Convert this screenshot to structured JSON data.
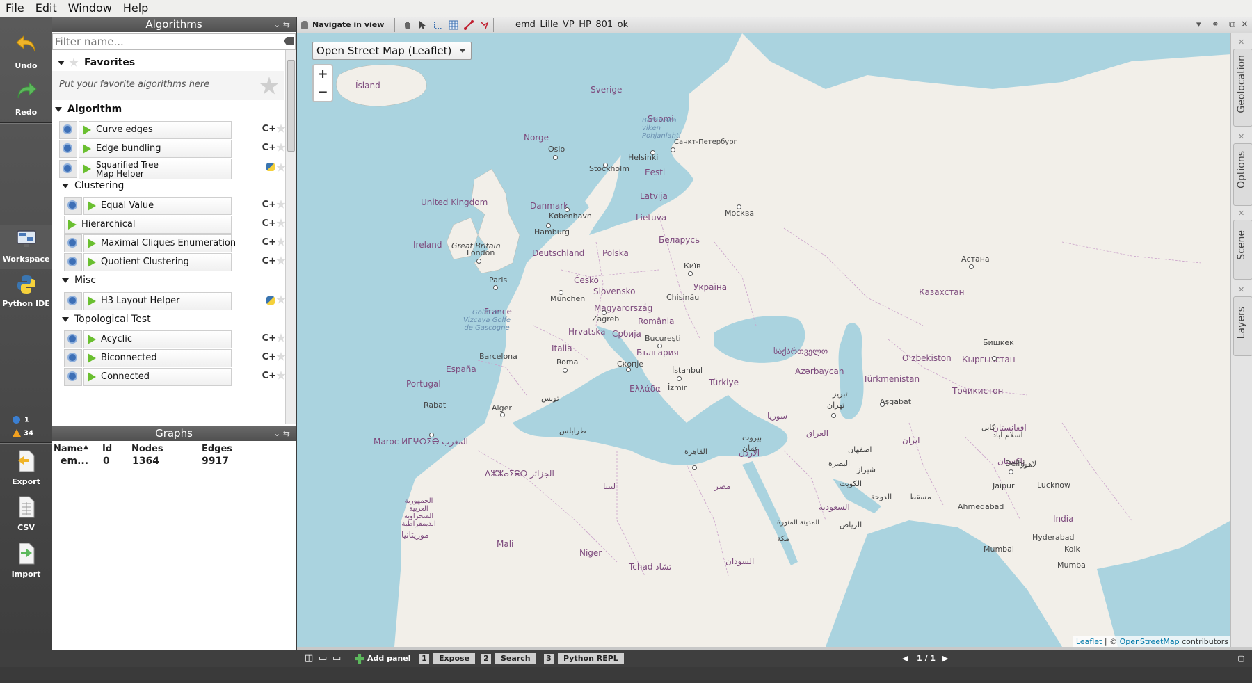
{
  "menu": [
    "File",
    "Edit",
    "Window",
    "Help"
  ],
  "left_toolbar": {
    "undo": "Undo",
    "redo": "Redo",
    "workspace": "Workspace",
    "python_ide": "Python IDE",
    "info_count": "1",
    "warning_count": "34",
    "export": "Export",
    "csv": "CSV",
    "import": "Import"
  },
  "algorithms": {
    "title": "Algorithms",
    "filter_placeholder": "Filter name...",
    "favorites": "Favorites",
    "favorites_hint": "Put your favorite algorithms here",
    "cat_algorithm": "Algorithm",
    "items_algorithm": [
      "Curve edges",
      "Edge bundling",
      "Squarified Tree",
      "Map Helper"
    ],
    "cat_clustering": "Clustering",
    "items_clustering": [
      "Equal Value",
      "Hierarchical",
      "Maximal Cliques Enumeration",
      "Quotient Clustering"
    ],
    "cat_misc": "Misc",
    "items_misc": [
      "H3 Layout Helper"
    ],
    "cat_topological": "Topological Test",
    "items_topological": [
      "Acyclic",
      "Biconnected",
      "Connected"
    ],
    "lang_cpp": "C+"
  },
  "graphs": {
    "title": "Graphs",
    "headers": [
      "Name",
      "Id",
      "Nodes",
      "Edges"
    ],
    "row": [
      "em...",
      "0",
      "1364",
      "9917"
    ]
  },
  "workspace": {
    "navigate": "Navigate in view",
    "tab_title": "emd_Lille_VP_HP_801_ok",
    "basemap": "Open Street Map (Leaflet)",
    "zoom_in": "+",
    "zoom_out": "−",
    "attribution_leaflet": "Leaflet",
    "attribution_sep": " | © ",
    "attribution_osm": "OpenStreetMap",
    "attribution_tail": " contributors",
    "side_tabs": [
      "Geolocation",
      "Options",
      "Scene",
      "Layers"
    ]
  },
  "bottom": {
    "add_panel": "Add panel",
    "expose_num": "1",
    "expose": "Expose",
    "search_num": "2",
    "search": "Search",
    "python_num": "3",
    "python": "Python REPL",
    "page": "1 / 1"
  },
  "map_labels": {
    "countries": [
      "Ísland",
      "Sverige",
      "Suomi",
      "Norge",
      "Eesti",
      "Latvija",
      "Lietuva",
      "Danmark",
      "United Kingdom",
      "Ireland",
      "Deutschland",
      "Polska",
      "Беларусь",
      "Україна",
      "France",
      "Česko",
      "Slovensko",
      "Magyarország",
      "România",
      "Hrvatska",
      "Србија",
      "България",
      "Italia",
      "España",
      "Portugal",
      "Türkiye",
      "Ελλάδα",
      "Azərbaycan",
      "Türkmenistan",
      "Oʻzbekiston",
      "Казахстан",
      "Кыргызстан",
      "Точикистон",
      "Maroc ⵍⵎⵖⵔⵉⴱ المغرب",
      "ⴷⵣⵣⴰⵢⴻⵔ الجزائر",
      "ليبيا",
      "مصر",
      "السودان",
      "Niger",
      "Mali",
      "Tchad تشاد",
      "India",
      "پاکستان",
      "افغانستان",
      "ایران",
      "العراق",
      "سوريا",
      "الأردن",
      "السعودية",
      "موريتانيا",
      "الجمهورية العربية الصحراوية الديمقراطية",
      "საქართველო",
      "Chisinău"
    ],
    "cities": [
      "Oslo",
      "Stockholm",
      "Helsinki",
      "Санкт-Петербург",
      "Москва",
      "København",
      "Hamburg",
      "London",
      "Great Britain",
      "Paris",
      "München",
      "Zagreb",
      "Київ",
      "Bucureşti",
      "Barcelona",
      "Roma",
      "Скопје",
      "İstanbul",
      "İzmir",
      "Rabat",
      "Alger",
      "تونس",
      "طرابلس",
      "القاهرة",
      "Астана",
      "Бишкек",
      "Aşgabat",
      "تهران",
      "Delhi",
      "Jaipur",
      "Lucknow",
      "Ahmedabad",
      "Mumbai",
      "Hyderabad",
      "Kolk",
      "Mumba",
      "الدوحة",
      "مسقط",
      "الرياض",
      "مكة",
      "المدينة المنورة",
      "اصفهان",
      "شيراز",
      "لاهور",
      "اسلام آباد",
      "كابل",
      "الكويت",
      "البصرة",
      "بيروت",
      "عمان",
      "تبریز",
      "Bothniska viken Pohjanlahti",
      "Golfo de Vizcaya Golfe de Gascogne"
    ]
  },
  "colors": {
    "water": "#aad3df",
    "land": "#f2efe9",
    "accent_green": "#6abf30"
  }
}
